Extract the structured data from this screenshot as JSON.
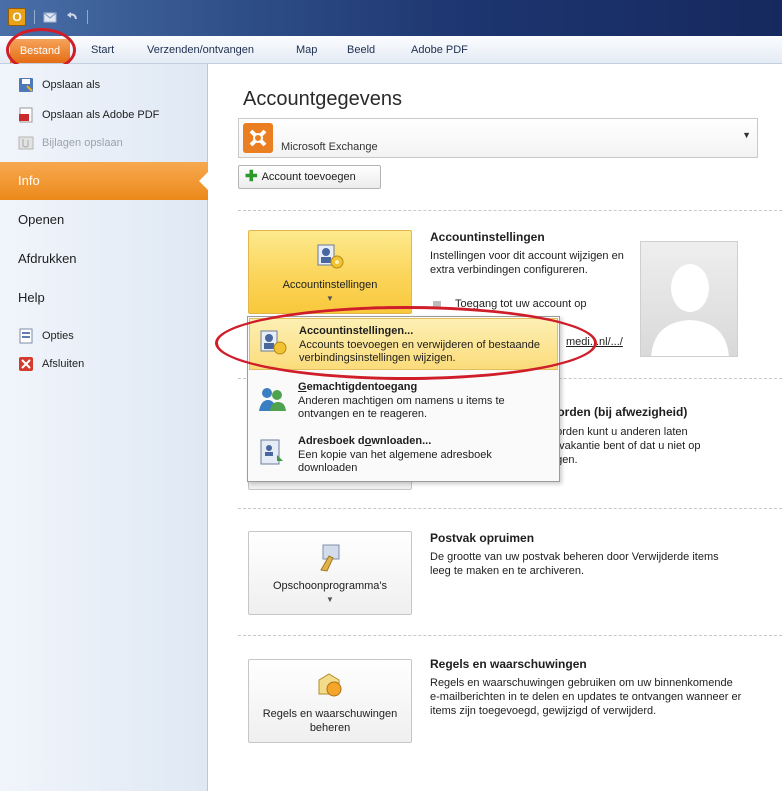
{
  "ribbon": {
    "tabs": [
      {
        "label": "Bestand"
      },
      {
        "label": "Start"
      },
      {
        "label": "Verzenden/ontvangen"
      },
      {
        "label": "Map"
      },
      {
        "label": "Beeld"
      },
      {
        "label": "Adobe PDF"
      }
    ]
  },
  "backstage": {
    "commands_top": [
      {
        "label": "Opslaan als",
        "icon": "save-as-icon"
      },
      {
        "label": "Opslaan als Adobe PDF",
        "icon": "pdf-icon"
      },
      {
        "label": "Bijlagen opslaan",
        "icon": "attachment-icon",
        "disabled": true
      }
    ],
    "nav": [
      {
        "label": "Info",
        "active": true
      },
      {
        "label": "Openen"
      },
      {
        "label": "Afdrukken"
      },
      {
        "label": "Help"
      }
    ],
    "commands_bottom": [
      {
        "label": "Opties",
        "icon": "options-icon"
      },
      {
        "label": "Afsluiten",
        "icon": "exit-icon"
      }
    ]
  },
  "info": {
    "heading": "Accountgegevens",
    "account_type": "Microsoft Exchange",
    "add_account_label": "Account toevoegen",
    "account_settings": {
      "button_label": "Accountinstellingen",
      "title": "Accountinstellingen",
      "description": "Instellingen voor dit account wijzigen en extra verbindingen configureren.",
      "bullet_text": "Toegang tot uw account op",
      "link_text": "medi...nl/.../"
    },
    "out_of_office": {
      "title_partial": "oorden (bij afwezigheid)",
      "desc_partial": "oorden kunt u anderen laten\np vakantie bent of dat u niet op\nagen."
    },
    "cleanup": {
      "button_label": "Opschoonprogramma's",
      "title": "Postvak opruimen",
      "description": "De grootte van uw postvak beheren door Verwijderde items leeg te maken en te archiveren."
    },
    "rules": {
      "button_label": "Regels en waarschuwingen beheren",
      "title": "Regels en waarschuwingen",
      "description": "Regels en waarschuwingen gebruiken om uw binnenkomende e-mailberichten in te delen en updates te ontvangen wanneer er items zijn toegevoegd, gewijzigd of verwijderd."
    }
  },
  "dropdown": {
    "items": [
      {
        "title": "Accountinstellingen...",
        "description": "Accounts toevoegen en verwijderen of bestaande verbindingsinstellingen wijzigen."
      },
      {
        "title_pre": "",
        "title_underlined": "G",
        "title_post": "emachtigdentoegang",
        "description": "Anderen machtigen om namens u items te ontvangen en te reageren."
      },
      {
        "title_pre": "Adresboek d",
        "title_underlined": "o",
        "title_post": "wnloaden...",
        "description": "Een kopie van het algemene adresboek downloaden"
      }
    ]
  },
  "colors": {
    "accent_orange": "#ec8a1b",
    "highlight_yellow": "#fbd55a",
    "annotation_red": "#cf1e2a"
  }
}
